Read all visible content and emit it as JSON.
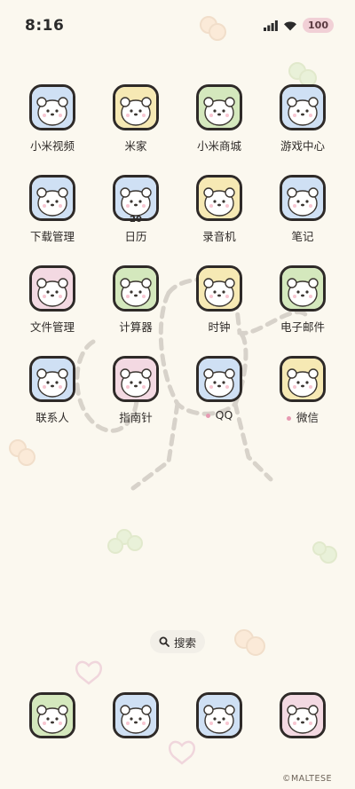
{
  "status": {
    "time": "8:16",
    "battery": "100"
  },
  "apps": [
    {
      "label": "小米视频",
      "icon": "video-icon",
      "color": "#cfe0f4"
    },
    {
      "label": "米家",
      "icon": "home-icon",
      "color": "#f6e9b4"
    },
    {
      "label": "小米商城",
      "icon": "mall-icon",
      "color": "#d4e8bd"
    },
    {
      "label": "游戏中心",
      "icon": "game-icon",
      "color": "#cfe0f4"
    },
    {
      "label": "下载管理",
      "icon": "download-icon",
      "color": "#cfe0f4"
    },
    {
      "label": "日历",
      "icon": "calendar-icon",
      "color": "#cfe0f4",
      "badge": "20"
    },
    {
      "label": "录音机",
      "icon": "recorder-icon",
      "color": "#f6e9b4"
    },
    {
      "label": "笔记",
      "icon": "notes-icon",
      "color": "#cfe0f4"
    },
    {
      "label": "文件管理",
      "icon": "files-icon",
      "color": "#f3d9e2"
    },
    {
      "label": "计算器",
      "icon": "calculator-icon",
      "color": "#d4e8bd"
    },
    {
      "label": "时钟",
      "icon": "clock-icon",
      "color": "#f6e9b4"
    },
    {
      "label": "电子邮件",
      "icon": "mail-icon",
      "color": "#d4e8bd"
    },
    {
      "label": "联系人",
      "icon": "contacts-icon",
      "color": "#cfe0f4"
    },
    {
      "label": "指南针",
      "icon": "compass-icon",
      "color": "#f3d9e2"
    },
    {
      "label": "QQ",
      "icon": "qq-icon",
      "color": "#cfe0f4",
      "dot": true
    },
    {
      "label": "微信",
      "icon": "wechat-icon",
      "color": "#f6e9b4",
      "dot": true
    }
  ],
  "search": {
    "label": "搜索",
    "icon": "search-icon"
  },
  "dock": [
    {
      "icon": "phone-icon",
      "color": "#d4e8bd"
    },
    {
      "icon": "browser-icon",
      "color": "#cfe0f4"
    },
    {
      "icon": "messages-icon",
      "color": "#cfe0f4"
    },
    {
      "icon": "camera-icon",
      "color": "#f3d9e2"
    }
  ],
  "watermark": "©MALTESE"
}
